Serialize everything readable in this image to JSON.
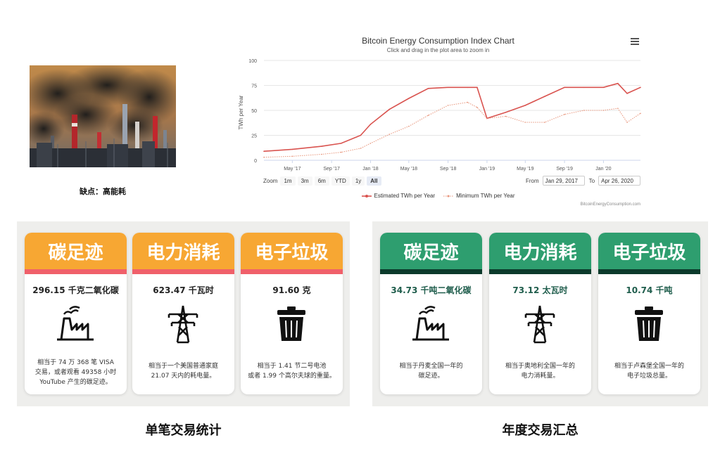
{
  "photo": {
    "caption": "缺点：高能耗"
  },
  "chart": {
    "title": "Bitcoin Energy Consumption Index Chart",
    "subtitle": "Click and drag in the plot area to zoom in",
    "ylabel": "TWh per Year",
    "yticks": [
      "0",
      "25",
      "50",
      "75",
      "100"
    ],
    "xticks": [
      "May '17",
      "Sep '17",
      "Jan '18",
      "May '18",
      "Sep '18",
      "Jan '19",
      "May '19",
      "Sep '19",
      "Jan '20"
    ],
    "zoom_label": "Zoom",
    "zoom_buttons": [
      "1m",
      "3m",
      "6m",
      "YTD",
      "1y",
      "All"
    ],
    "from_label": "From",
    "from_value": "Jan 29, 2017",
    "to_label": "To",
    "to_value": "Apr 26, 2020",
    "legend": [
      "Estimated TWh per Year",
      "Minimum TWh per Year"
    ],
    "credits": "BitcoinEnergyConsumption.com",
    "colors": {
      "estimated": "#d9534f",
      "minimum": "#e8957b"
    }
  },
  "chart_data": {
    "type": "line",
    "title": "Bitcoin Energy Consumption Index Chart",
    "ylabel": "TWh per Year",
    "ylim": [
      0,
      100
    ],
    "x": [
      "2017-02-01",
      "2017-05-01",
      "2017-08-01",
      "2017-10-01",
      "2017-12-01",
      "2018-01-01",
      "2018-03-01",
      "2018-05-01",
      "2018-07-01",
      "2018-09-01",
      "2018-11-01",
      "2018-12-01",
      "2019-01-01",
      "2019-03-01",
      "2019-05-01",
      "2019-07-01",
      "2019-09-01",
      "2019-11-01",
      "2020-01-01",
      "2020-02-15",
      "2020-03-15",
      "2020-04-26"
    ],
    "series": [
      {
        "name": "Estimated TWh per Year",
        "values": [
          9,
          11,
          14,
          17,
          25,
          36,
          51,
          62,
          72,
          73,
          73,
          73,
          42,
          48,
          55,
          64,
          73,
          73,
          73,
          77,
          67,
          73
        ]
      },
      {
        "name": "Minimum TWh per Year",
        "values": [
          3,
          4,
          6,
          8,
          12,
          17,
          26,
          34,
          45,
          55,
          58,
          53,
          42,
          44,
          38,
          38,
          46,
          50,
          50,
          52,
          38,
          47
        ]
      }
    ]
  },
  "single": {
    "title": "单笔交易统计",
    "cards": [
      {
        "head": "碳足迹",
        "value": "296.15 千克二氧化碳",
        "desc": [
          "相当于 74 万 368 笔 VISA",
          "交易，或者观看 49358 小时",
          "YouTube 产生的碳足迹。"
        ],
        "icon": "factory-icon"
      },
      {
        "head": "电力消耗",
        "value": "623.47 千瓦时",
        "desc": [
          "相当于一个美国普通家庭",
          "21.07 天内的耗电量。"
        ],
        "icon": "power-tower-icon"
      },
      {
        "head": "电子垃圾",
        "value": "91.60 克",
        "desc": [
          "相当于 1.41 节二号电池",
          "或者 1.99 个高尔夫球的重量。"
        ],
        "icon": "trash-bin-icon"
      }
    ]
  },
  "annual": {
    "title": "年度交易汇总",
    "cards": [
      {
        "head": "碳足迹",
        "value": "34.73 千吨二氧化碳",
        "desc": [
          "相当于丹麦全国一年的",
          "碳足迹。"
        ],
        "icon": "factory-icon"
      },
      {
        "head": "电力消耗",
        "value": "73.12 太瓦时",
        "desc": [
          "相当于奥地利全国一年的",
          "电力消耗量。"
        ],
        "icon": "power-tower-icon"
      },
      {
        "head": "电子垃圾",
        "value": "10.74 千吨",
        "desc": [
          "相当于卢森堡全国一年的",
          "电子垃圾总量。"
        ],
        "icon": "trash-bin-icon"
      }
    ]
  }
}
